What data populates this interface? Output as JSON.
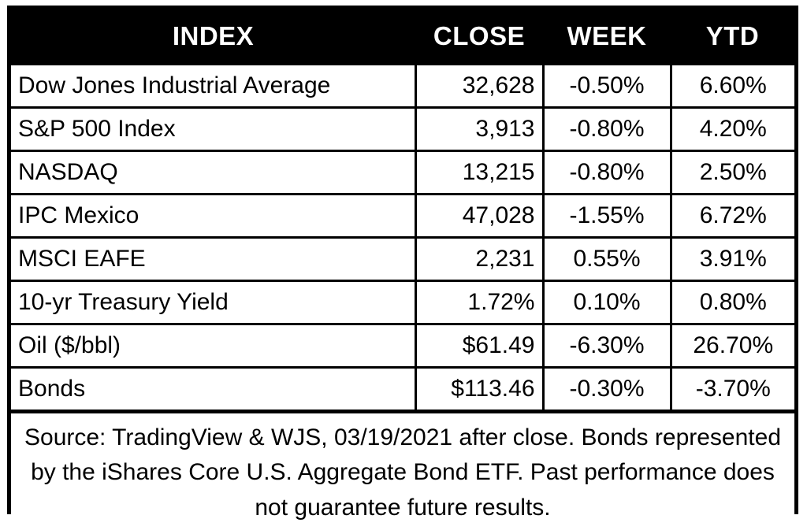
{
  "table": {
    "columns": [
      "INDEX",
      "CLOSE",
      "WEEK",
      "YTD"
    ],
    "rows": [
      {
        "index": "Dow Jones Industrial Average",
        "close": "32,628",
        "week": "-0.50%",
        "ytd": "6.60%"
      },
      {
        "index": "S&P 500 Index",
        "close": "3,913",
        "week": "-0.80%",
        "ytd": "4.20%"
      },
      {
        "index": "NASDAQ",
        "close": "13,215",
        "week": "-0.80%",
        "ytd": "2.50%"
      },
      {
        "index": "IPC Mexico",
        "close": "47,028",
        "week": "-1.55%",
        "ytd": "6.72%"
      },
      {
        "index": "MSCI EAFE",
        "close": "2,231",
        "week": "0.55%",
        "ytd": "3.91%"
      },
      {
        "index": "10-yr Treasury Yield",
        "close": "1.72%",
        "week": "0.10%",
        "ytd": "0.80%"
      },
      {
        "index": "Oil ($/bbl)",
        "close": "$61.49",
        "week": "-6.30%",
        "ytd": "26.70%"
      },
      {
        "index": "Bonds",
        "close": "$113.46",
        "week": "-0.30%",
        "ytd": "-3.70%"
      }
    ],
    "footnote": "Source: TradingView & WJS, 03/19/2021 after close. Bonds represented by the iShares Core U.S. Aggregate Bond ETF. Past performance does not guarantee future results."
  },
  "colors": {
    "header_background": "#000000",
    "header_text": "#ffffff",
    "body_background": "#ffffff",
    "body_text": "#000000",
    "border": "#000000"
  }
}
